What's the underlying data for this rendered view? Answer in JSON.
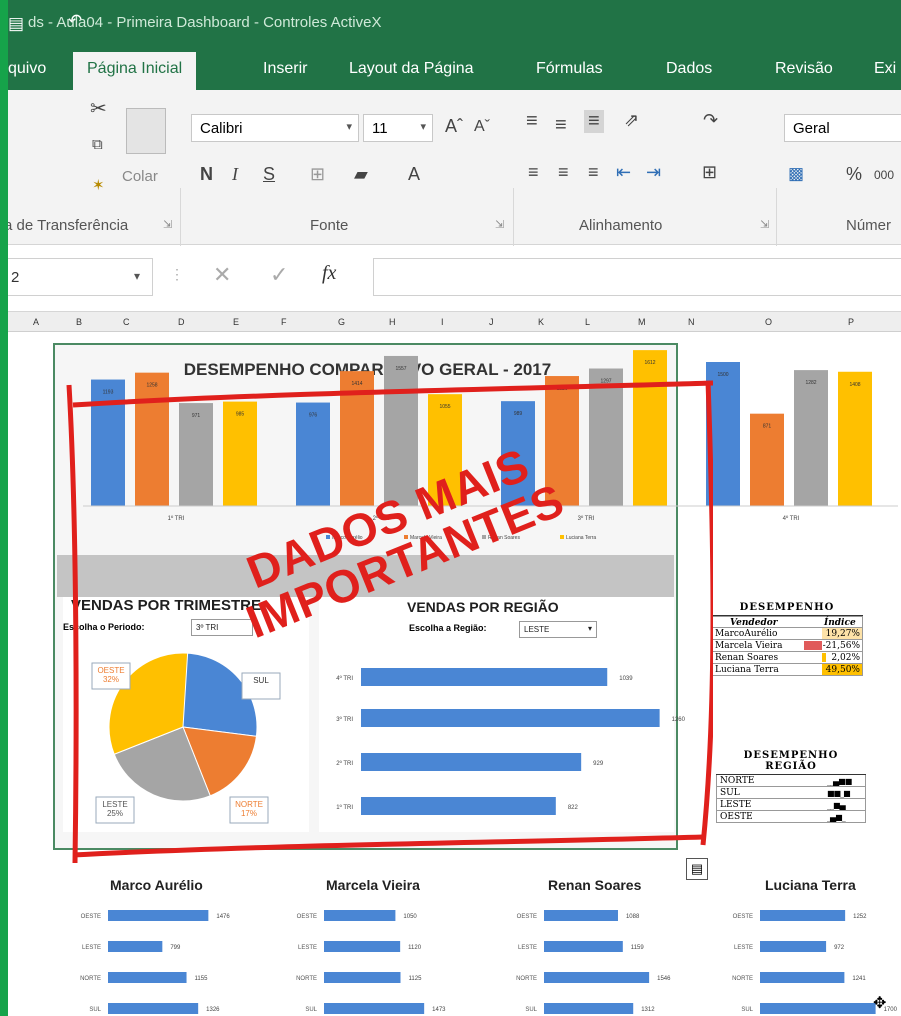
{
  "window": {
    "title": "ds - Aula04 - Primeira Dashboard - Controles ActiveX"
  },
  "menu": {
    "tabs": [
      "quivo",
      "Página Inicial",
      "Inserir",
      "Layout da Página",
      "Fórmulas",
      "Dados",
      "Revisão",
      "Exi"
    ]
  },
  "ribbon": {
    "paste_label": "Colar",
    "font_name": "Calibri",
    "font_size": "11",
    "bold": "N",
    "italic": "I",
    "underline": "S",
    "number_format": "Geral",
    "percent": "%",
    "thousands": "000",
    "groups": {
      "clipboard": "a de Transferência",
      "font": "Fonte",
      "alignment": "Alinhamento",
      "number": "Númer"
    }
  },
  "formula_bar": {
    "name_box": "2",
    "fx": "fx",
    "formula": ""
  },
  "columns": [
    "A",
    "B",
    "C",
    "D",
    "E",
    "F",
    "G",
    "H",
    "I",
    "J",
    "K",
    "L",
    "M",
    "N",
    "O",
    "P"
  ],
  "dashboard": {
    "title": "DESEMPENHO COMPARATIVO GERAL - 2017",
    "vendas_trimestre": {
      "title": "VENDAS POR TRIMESTRE",
      "period_label": "Escolha o Periodo:",
      "period_value": "3º TRI"
    },
    "vendas_regiao": {
      "title": "VENDAS POR REGIÃO",
      "region_label": "Escolha a Região:",
      "region_value": "LESTE"
    },
    "desempenho": {
      "title": "DESEMPENHO",
      "col_vendedor": "Vendedor",
      "col_indice": "Índice",
      "rows": [
        {
          "name": "MarcoAurélio",
          "value": "19,27%"
        },
        {
          "name": "Marcela Vieira",
          "value": "-21,56%"
        },
        {
          "name": "Renan Soares",
          "value": "2,02%"
        },
        {
          "name": "Luciana Terra",
          "value": "49,50%"
        }
      ]
    },
    "desempenho_regiao": {
      "title": "DESEMPENHO REGIÃO",
      "rows": [
        "NORTE",
        "SUL",
        "LESTE",
        "OESTE"
      ]
    }
  },
  "annotation": {
    "line1": "DADOS MAIS",
    "line2": "IMPORTANTES"
  },
  "colors": {
    "excel_green": "#217346",
    "outer_frame": "#16a34a",
    "annotation_red": "#e0201c",
    "blue": "#4a86d4",
    "orange": "#ed7d31",
    "gray": "#a5a5a5",
    "yellow": "#ffc000"
  },
  "chart_data": [
    {
      "type": "bar",
      "title": "DESEMPENHO COMPARATIVO GERAL - 2017",
      "categories": [
        "1º TRI",
        "2º TRI",
        "3º TRI",
        "4º TRI"
      ],
      "series": [
        {
          "name": "Marco Aurélio",
          "values": [
            1193,
            976,
            989,
            1500
          ]
        },
        {
          "name": "Marcela Vieira",
          "values": [
            1258,
            1414,
            1226,
            871
          ]
        },
        {
          "name": "Renan Soares",
          "values": [
            971,
            1557,
            1297,
            1282
          ]
        },
        {
          "name": "Luciana Terra",
          "values": [
            985,
            1055,
            1612,
            1408
          ]
        }
      ],
      "legend": "bottom",
      "ylim": [
        0,
        1700
      ]
    },
    {
      "type": "pie",
      "title": "VENDAS POR TRIMESTRE",
      "slices": [
        {
          "label": "SUL",
          "percent": 27
        },
        {
          "label": "NORTE",
          "percent": 17
        },
        {
          "label": "LESTE",
          "percent": 25
        },
        {
          "label": "OESTE",
          "percent": 32
        }
      ],
      "slice_labels": [
        "OESTE\n32%",
        "SUL",
        "LESTE\n25%",
        "NORTE\n17%"
      ]
    },
    {
      "type": "bar",
      "orientation": "horizontal",
      "title": "VENDAS POR REGIÃO",
      "categories": [
        "4º TRI",
        "3º TRI",
        "2º TRI",
        "1º TRI"
      ],
      "values": [
        1039,
        1260,
        929,
        822
      ]
    },
    {
      "type": "bar",
      "orientation": "horizontal",
      "title": "Marco Aurélio",
      "categories": [
        "OESTE",
        "LESTE",
        "NORTE",
        "SUL"
      ],
      "values": [
        1476,
        799,
        1155,
        1326
      ]
    },
    {
      "type": "bar",
      "orientation": "horizontal",
      "title": "Marcela Vieira",
      "categories": [
        "OESTE",
        "LESTE",
        "NORTE",
        "SUL"
      ],
      "values": [
        1050,
        1120,
        1125,
        1473
      ]
    },
    {
      "type": "bar",
      "orientation": "horizontal",
      "title": "Renan Soares",
      "categories": [
        "OESTE",
        "LESTE",
        "NORTE",
        "SUL"
      ],
      "values": [
        1088,
        1159,
        1546,
        1312
      ]
    },
    {
      "type": "bar",
      "orientation": "horizontal",
      "title": "Luciana Terra",
      "categories": [
        "OESTE",
        "LESTE",
        "NORTE",
        "SUL"
      ],
      "values": [
        1252,
        972,
        1241,
        1700
      ]
    }
  ]
}
